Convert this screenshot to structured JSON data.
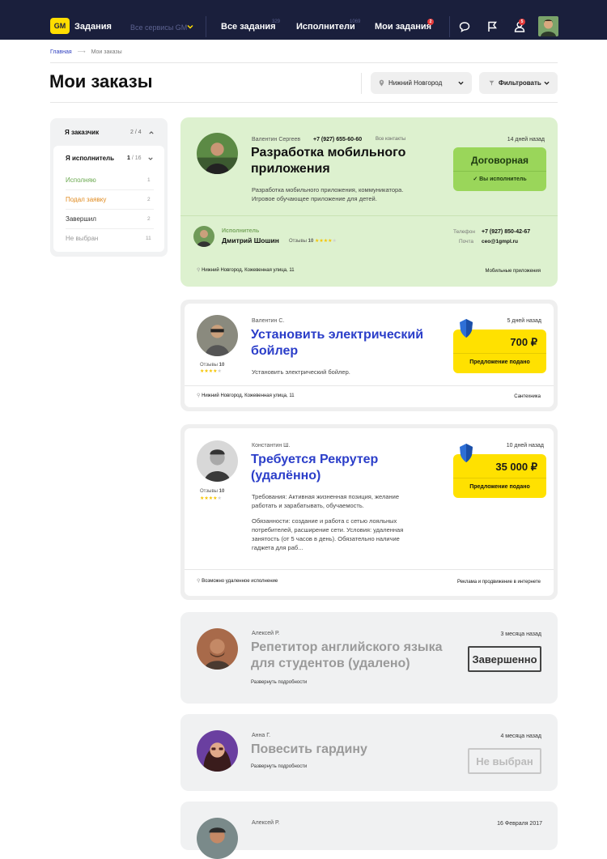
{
  "topbar": {
    "logo": "GM",
    "app_title": "Задания",
    "services": "Все сервисы GM",
    "nav": [
      {
        "label": "Все задания",
        "count": "329"
      },
      {
        "label": "Исполнители",
        "count": "1069"
      },
      {
        "label": "Мои задания",
        "count": "2"
      }
    ],
    "notifications_count": "5"
  },
  "breadcrumbs": {
    "home": "Главная",
    "arrow": "⟶",
    "current": "Мои заказы"
  },
  "page": {
    "title": "Мои заказы",
    "city": "Нижний Новгород",
    "filter": "Фильтровать"
  },
  "sidebar": {
    "customer": {
      "label": "Я заказчик",
      "count": "2",
      "total": "4"
    },
    "executor": {
      "label": "Я исполнитель",
      "count": "1",
      "total": "16"
    },
    "items": [
      {
        "label": "Исполняю",
        "count": "1",
        "color": "#6aa84f"
      },
      {
        "label": "Подал заявку",
        "count": "2",
        "color": "#e08a1e"
      },
      {
        "label": "Завершил",
        "count": "2",
        "color": "#333333"
      },
      {
        "label": "Не выбран",
        "count": "11",
        "color": "#999999"
      }
    ]
  },
  "cards": [
    {
      "author": "Валентин Сергеев",
      "phone": "+7 (927) 655-60-60",
      "contacts": "Все контакты",
      "time": "14 дней назад",
      "title_l1": "Разработка мобильного",
      "title_l2": "приложения",
      "desc_l1": "Разработка мобильного приложения, коммуникатора.",
      "desc_l2": "Игровое обучающее приложение для детей.",
      "price": "Договорная",
      "status": "Вы исполнитель",
      "executor_label": "Исполнитель",
      "executor_name": "Дмитрий Шошин",
      "reviews_label": "Отзывы",
      "reviews": "10",
      "phone_label": "Телефон",
      "exec_phone": "+7 (927) 850-42-67",
      "mail_label": "Почта",
      "mail": "ceo@1gmpl.ru",
      "address": "Нижний Новгород, Кожевенная улица, 11",
      "category": "Мобильные приложения",
      "accent": "#ddf1cf",
      "price_bg": "#9ad65a"
    },
    {
      "author": "Валентин С.",
      "time": "5 дней назад",
      "title_l1": "Установить электрический",
      "title_l2": "бойлер",
      "desc_l1": "Установить электрический бойлер.",
      "reviews_label": "Отзывы",
      "reviews": "10",
      "price": "700 ₽",
      "status": "Предложение подано",
      "address": "Нижний Новгород, Кожевенная улица, 11",
      "category": "Сантехника",
      "price_bg": "#ffe100"
    },
    {
      "author": "Константин Ш.",
      "time": "10 дней назад",
      "title_l1": "Требуется Рекрутер",
      "title_l2": "(удалённо)",
      "desc_l1": "Требования: Активная жизненная позиция, желание",
      "desc_l2": "работать и зарабатывать, обучаемость.",
      "desc_l3": "Обязанности: создание и работа с сетью лояльных",
      "desc_l4": "потребителей, расширение сети. Условия: удаленная",
      "desc_l5": "занятость (от 5 часов в день). Обязательно наличие",
      "desc_l6": "гаджета для раб...",
      "reviews_label": "Отзывы",
      "reviews": "10",
      "price": "35 000 ₽",
      "status": "Предложение подано",
      "address": "Возможно удаленное исполнение",
      "category": "Реклама и продвижение в интернете",
      "price_bg": "#ffe100"
    },
    {
      "author": "Алексей Р.",
      "time": "3 месяца назад",
      "title_l1": "Репетитор английского языка",
      "title_l2": "для студентов (удалено)",
      "expand": "Развернуть подробности",
      "stamp": "Завершенно"
    },
    {
      "author": "Анна Г.",
      "time": "4 месяца назад",
      "title_l1": "Повесить гардину",
      "expand": "Развернуть подробности",
      "stamp": "Не выбран"
    },
    {
      "author": "Алексей Р.",
      "time": "16 Февраля 2017"
    }
  ],
  "rating": {
    "stars": 4,
    "max": 5
  }
}
